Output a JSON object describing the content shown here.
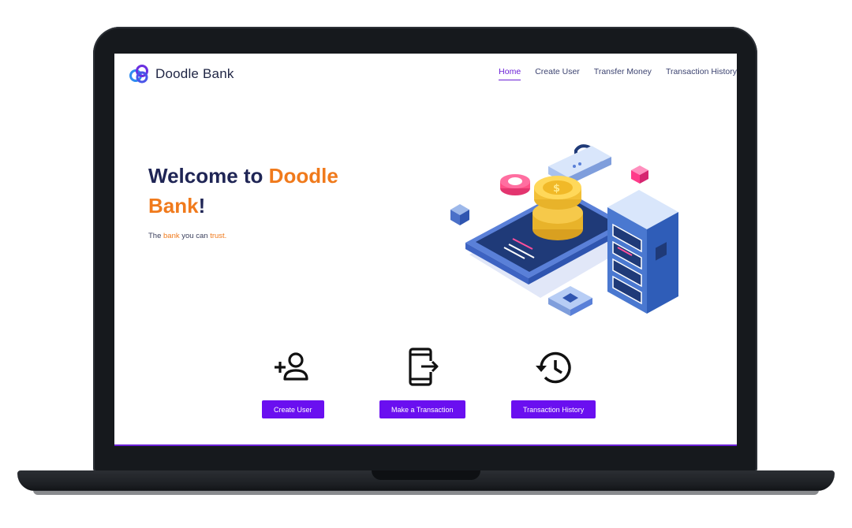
{
  "brand": {
    "name": "Doodle Bank"
  },
  "nav": {
    "items": [
      {
        "label": "Home",
        "active": true
      },
      {
        "label": "Create User",
        "active": false
      },
      {
        "label": "Transfer Money",
        "active": false
      },
      {
        "label": "Transaction History",
        "active": false
      }
    ]
  },
  "hero": {
    "title_prefix": "Welcome to ",
    "title_accent_1": "Doodle",
    "title_accent_2": "Bank",
    "title_suffix": "!",
    "sub_1": "The ",
    "sub_accent_1": "bank",
    "sub_2": " you can ",
    "sub_accent_2": "trust."
  },
  "actions": [
    {
      "icon": "add-user-icon",
      "label": "Create User"
    },
    {
      "icon": "mobile-transfer-icon",
      "label": "Make a Transaction"
    },
    {
      "icon": "history-icon",
      "label": "Transaction History"
    }
  ],
  "colors": {
    "accent": "#f07a1c",
    "primary": "#6a0ff0",
    "navy": "#1f2555"
  }
}
